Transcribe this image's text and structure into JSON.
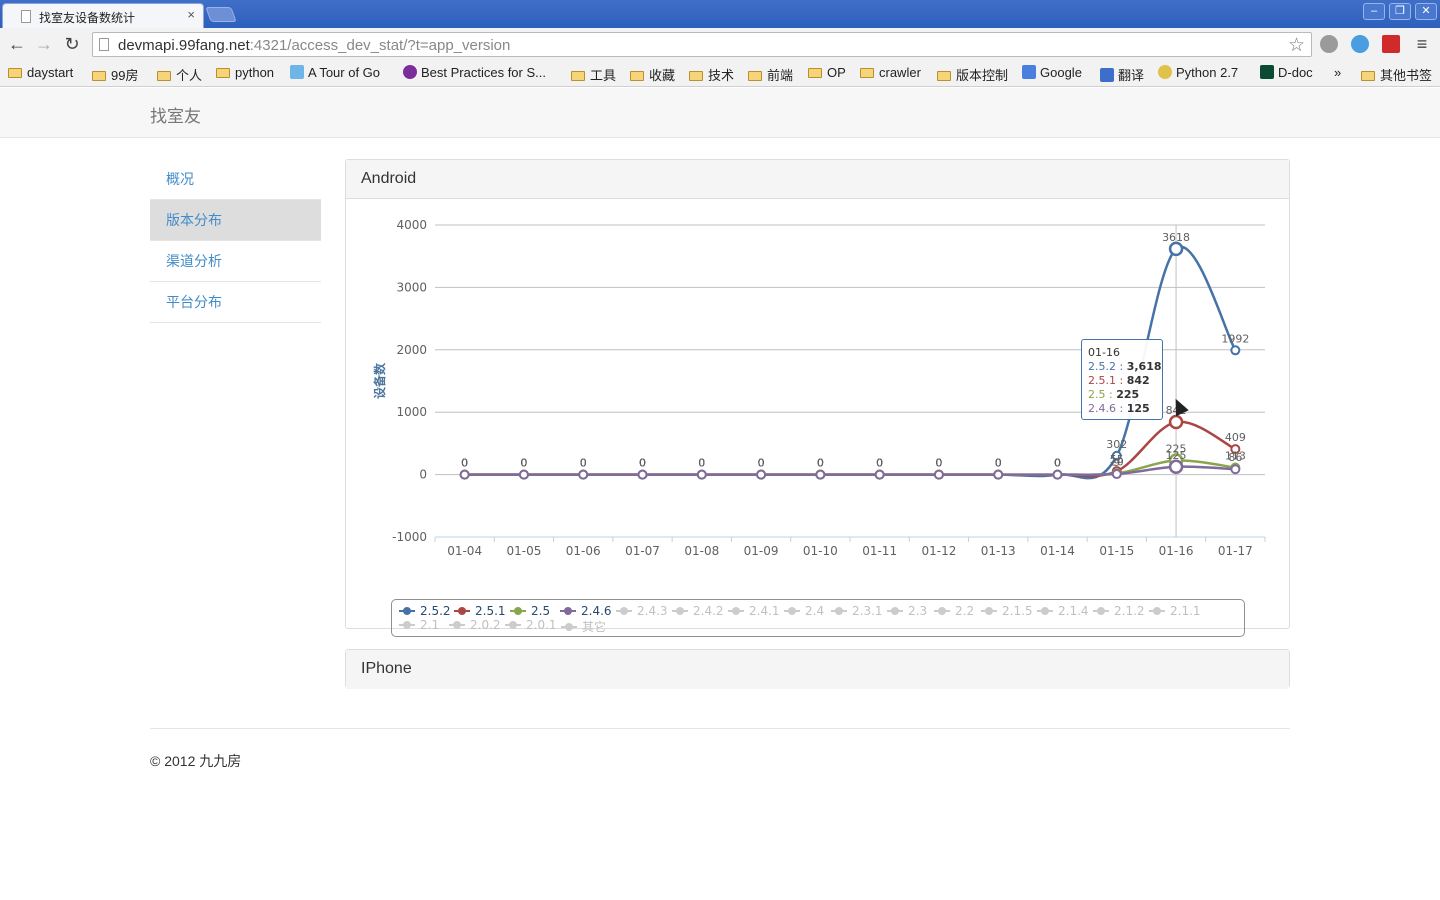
{
  "browser": {
    "tab_title": "找室友设备数统计",
    "tab_close": "×",
    "url_host": "devmapi.99fang.net",
    "url_rest": ":4321/access_dev_stat/?t=app_version",
    "bookmarks": [
      "daystart",
      "99房",
      "个人",
      "python",
      "A Tour of Go",
      "Best Practices for S...",
      "工具",
      "收藏",
      "技术",
      "前端",
      "OP",
      "crawler",
      "版本控制",
      "Google",
      "翻译",
      "Python 2.7",
      "D-doc",
      "»",
      "其他书签"
    ]
  },
  "navbar": {
    "brand": "找室友"
  },
  "sidebar": {
    "items": [
      {
        "label": "概况"
      },
      {
        "label": "版本分布"
      },
      {
        "label": "渠道分析"
      },
      {
        "label": "平台分布"
      }
    ]
  },
  "panels": {
    "android_title": "Android",
    "iphone_title": "IPhone"
  },
  "footer": {
    "text": "© 2012 九九房"
  },
  "chart_data": {
    "type": "line",
    "ylabel": "设备数",
    "ylim": [
      -1000,
      4000
    ],
    "yticks": [
      -1000,
      0,
      1000,
      2000,
      3000,
      4000
    ],
    "categories": [
      "01-04",
      "01-05",
      "01-06",
      "01-07",
      "01-08",
      "01-09",
      "01-10",
      "01-11",
      "01-12",
      "01-13",
      "01-14",
      "01-15",
      "01-16",
      "01-17"
    ],
    "grid": true,
    "legend_placement": "bottom",
    "series": [
      {
        "name": "2.5.2",
        "color": "#4572a7",
        "visible": true,
        "values": [
          0,
          0,
          0,
          0,
          0,
          0,
          0,
          0,
          0,
          0,
          0,
          302,
          3618,
          1992
        ]
      },
      {
        "name": "2.5.1",
        "color": "#aa4643",
        "visible": true,
        "values": [
          0,
          0,
          0,
          0,
          0,
          0,
          0,
          0,
          0,
          0,
          0,
          55,
          842,
          409
        ]
      },
      {
        "name": "2.5",
        "color": "#89a54e",
        "visible": true,
        "values": [
          0,
          0,
          0,
          0,
          0,
          0,
          0,
          0,
          0,
          0,
          0,
          20,
          225,
          113
        ]
      },
      {
        "name": "2.4.6",
        "color": "#80699b",
        "visible": true,
        "values": [
          0,
          0,
          0,
          0,
          0,
          0,
          0,
          0,
          0,
          0,
          0,
          9,
          125,
          86
        ]
      },
      {
        "name": "2.4.3",
        "visible": false
      },
      {
        "name": "2.4.2",
        "visible": false
      },
      {
        "name": "2.4.1",
        "visible": false
      },
      {
        "name": "2.4",
        "visible": false
      },
      {
        "name": "2.3.1",
        "visible": false
      },
      {
        "name": "2.3",
        "visible": false
      },
      {
        "name": "2.2",
        "visible": false
      },
      {
        "name": "2.1.5",
        "visible": false
      },
      {
        "name": "2.1.4",
        "visible": false
      },
      {
        "name": "2.1.2",
        "visible": false
      },
      {
        "name": "2.1.1",
        "visible": false
      },
      {
        "name": "2.1",
        "visible": false
      },
      {
        "name": "2.0.2",
        "visible": false
      },
      {
        "name": "2.0.1",
        "visible": false
      },
      {
        "name": "其它",
        "visible": false
      }
    ],
    "tooltip": {
      "date": "01-16",
      "rows": [
        {
          "name": "2.5.2",
          "value": "3,618",
          "color": "#4572a7"
        },
        {
          "name": "2.5.1",
          "value": "842",
          "color": "#aa4643"
        },
        {
          "name": "2.5",
          "value": "225",
          "color": "#89a54e"
        },
        {
          "name": "2.4.6",
          "value": "125",
          "color": "#80699b"
        }
      ]
    }
  }
}
